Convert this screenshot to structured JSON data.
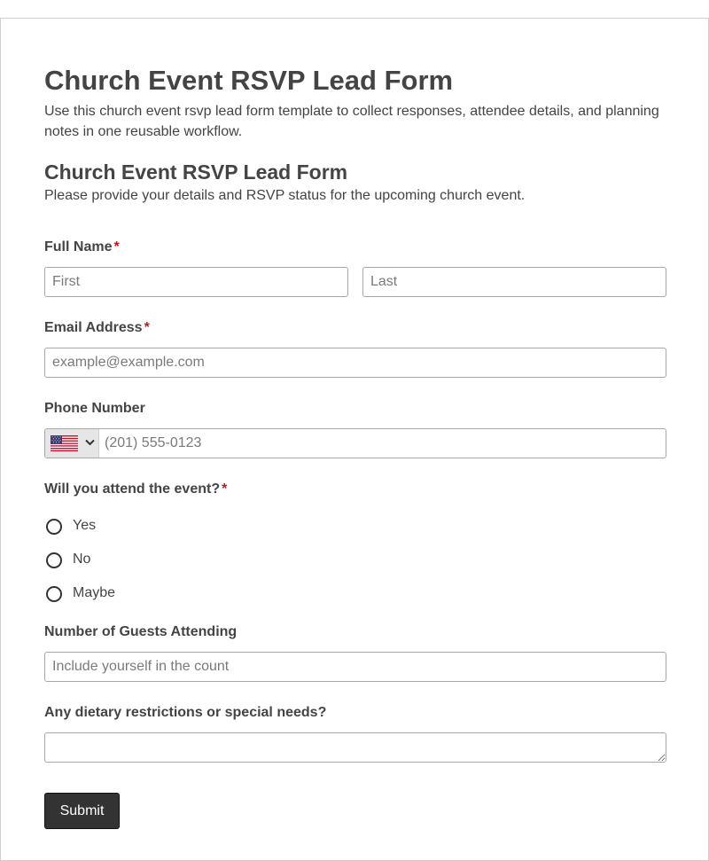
{
  "page": {
    "title": "Church Event RSVP Lead Form",
    "description": "Use this church event rsvp lead form template to collect responses, attendee details, and planning notes in one reusable workflow."
  },
  "form": {
    "title": "Church Event RSVP Lead Form",
    "description": "Please provide your details and RSVP status for the upcoming church event.",
    "required_marker": "*",
    "full_name": {
      "label": "Full Name",
      "required": true,
      "first_placeholder": "First",
      "first_value": "",
      "last_placeholder": "Last",
      "last_value": ""
    },
    "email": {
      "label": "Email Address",
      "required": true,
      "placeholder": "example@example.com",
      "value": ""
    },
    "phone": {
      "label": "Phone Number",
      "required": false,
      "country_icon": "us-flag-icon",
      "placeholder": "(201) 555-0123",
      "value": ""
    },
    "attendance": {
      "label": "Will you attend the event?",
      "required": true,
      "options": [
        "Yes",
        "No",
        "Maybe"
      ],
      "selected": null
    },
    "guests": {
      "label": "Number of Guests Attending",
      "required": false,
      "placeholder": "Include yourself in the count",
      "value": ""
    },
    "dietary": {
      "label": "Any dietary restrictions or special needs?",
      "required": false,
      "value": ""
    },
    "submit_label": "Submit"
  },
  "colors": {
    "text": "#444444",
    "required_marker": "#b91c1c",
    "button_bg": "#333333",
    "button_text": "#ffffff",
    "input_border": "#a8a8a8",
    "card_border": "#cfcfcf"
  }
}
